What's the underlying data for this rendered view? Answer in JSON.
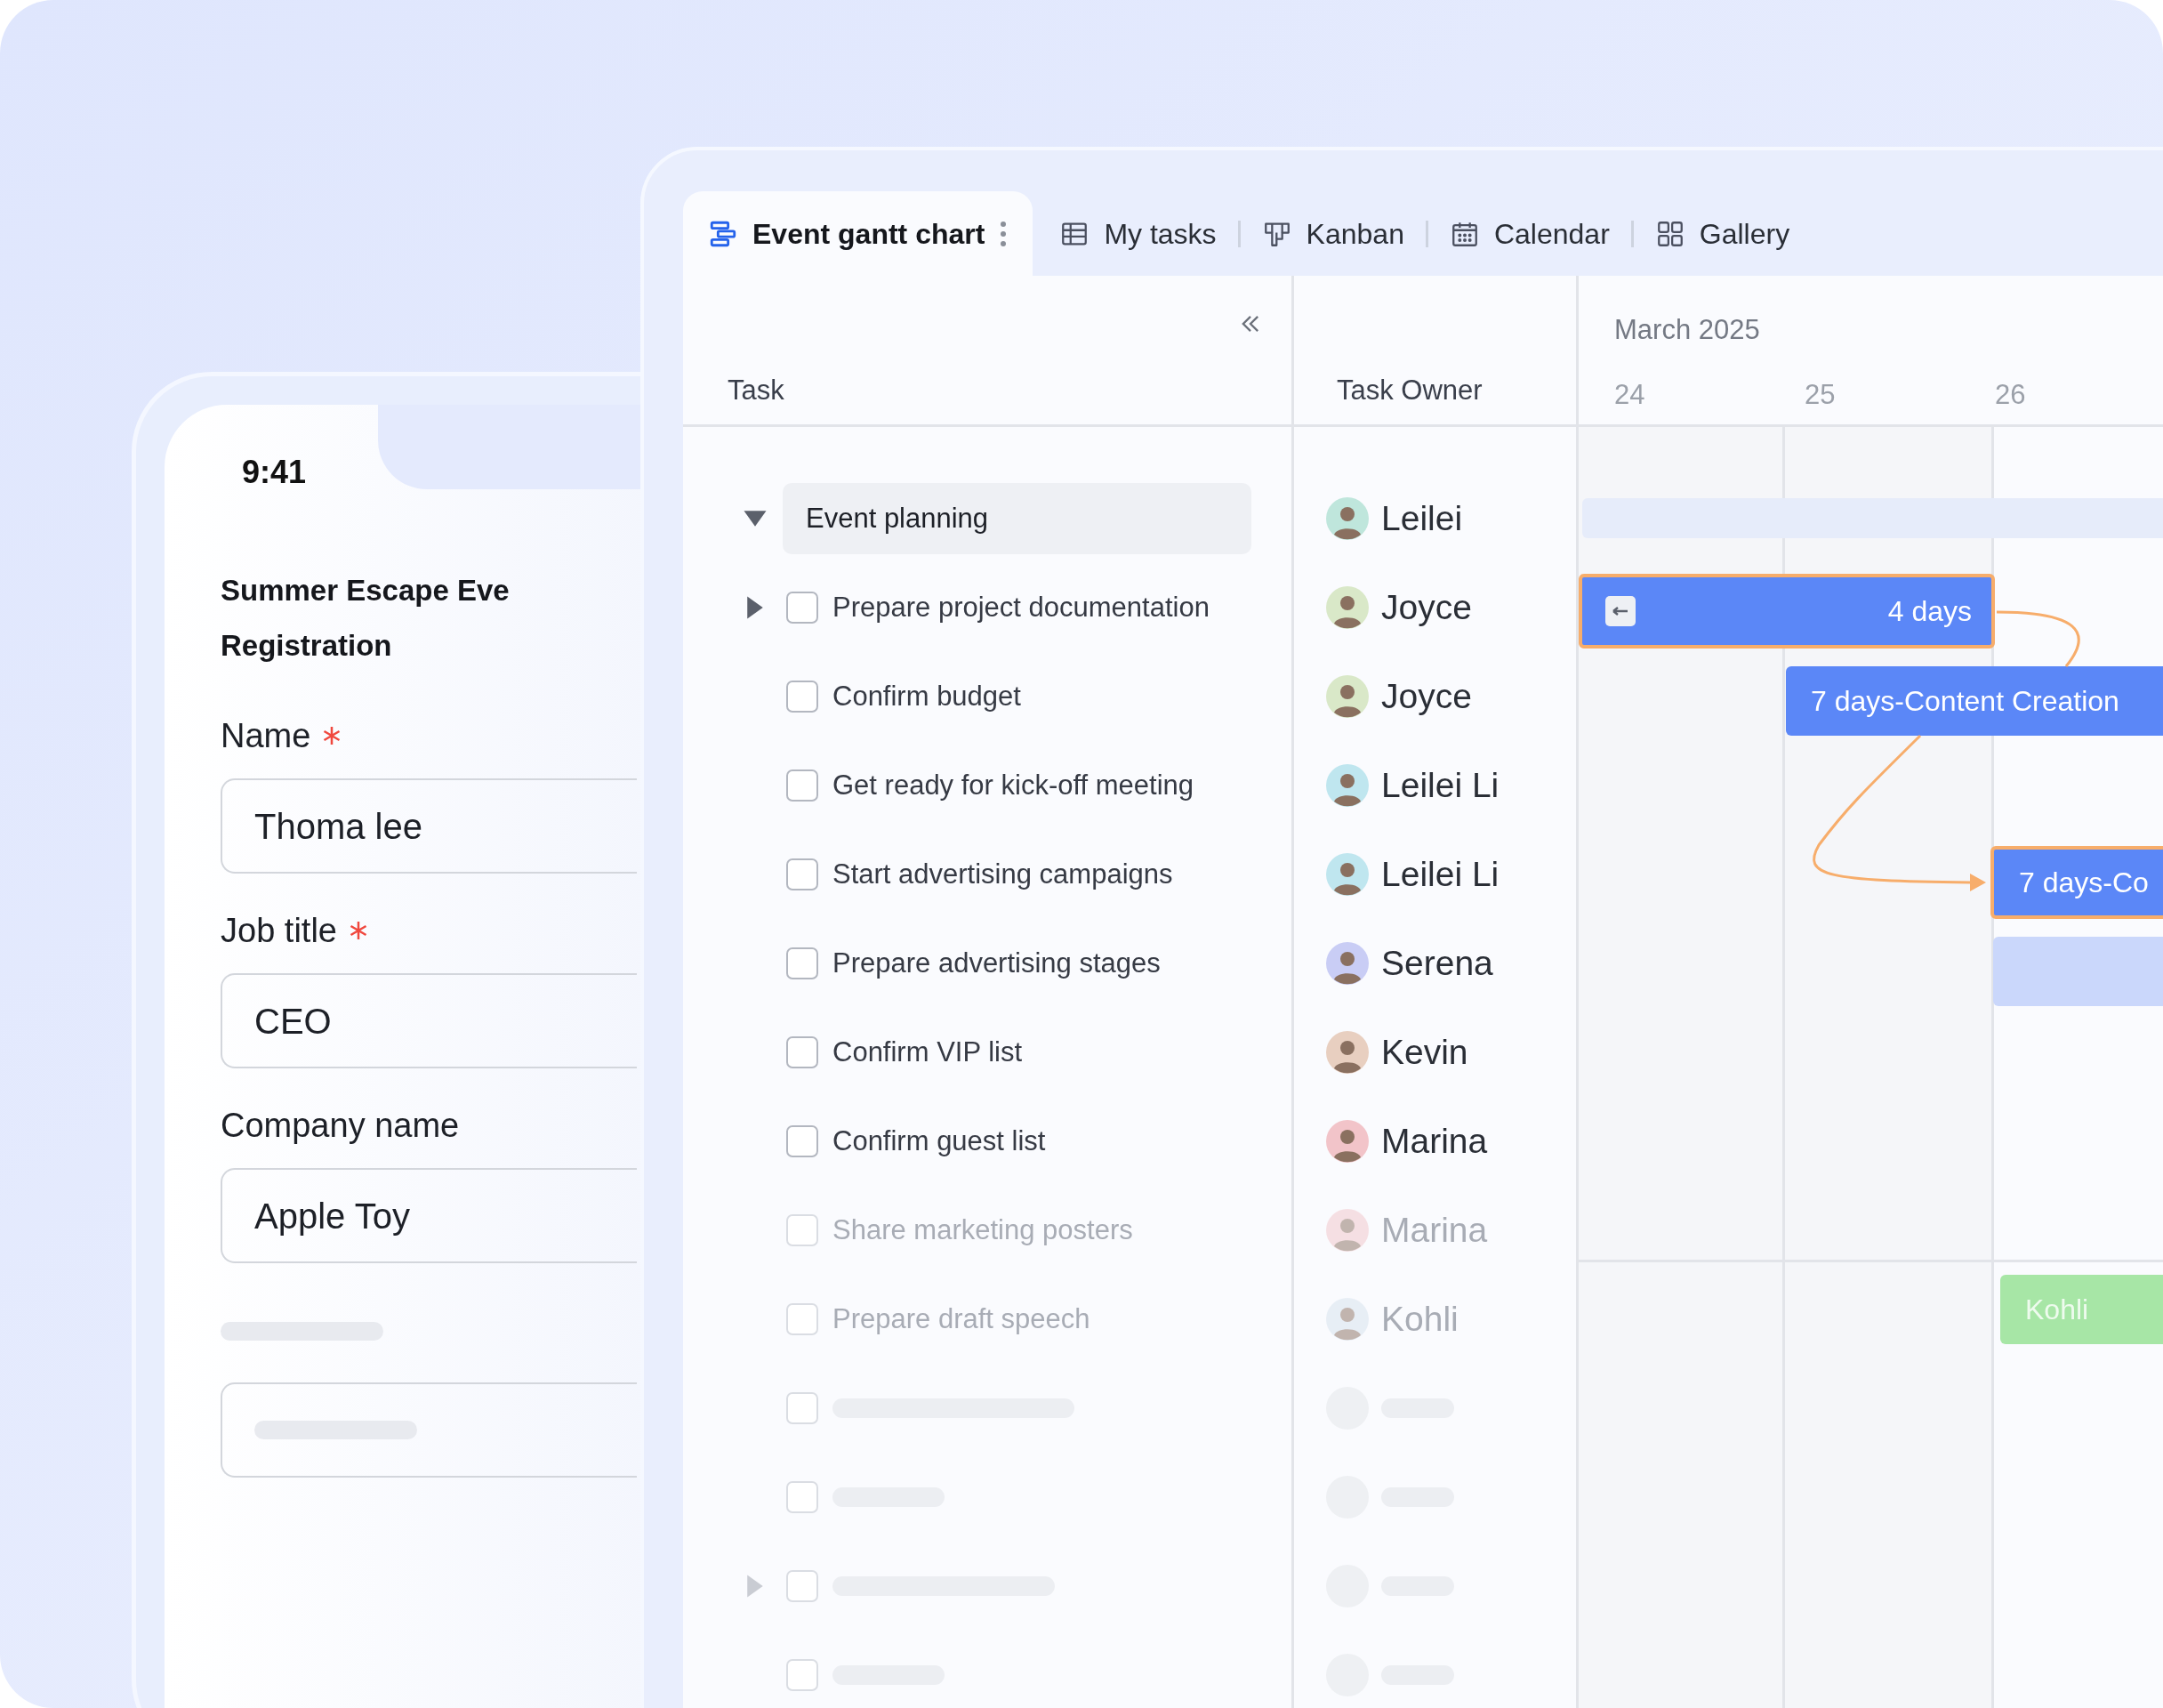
{
  "phone": {
    "time": "9:41",
    "title_lines": [
      "Summer Escape Eve",
      "Registration"
    ],
    "fields": [
      {
        "label": "Name",
        "required": true,
        "value": "Thoma lee"
      },
      {
        "label": "Job title",
        "required": true,
        "value": "CEO"
      },
      {
        "label": "Company name",
        "required": false,
        "value": "Apple Toy"
      },
      {
        "kind": "skeleton"
      }
    ]
  },
  "gantt": {
    "tabs": [
      {
        "label": "Event gantt chart",
        "selected": true
      },
      {
        "label": "My tasks",
        "selected": false
      },
      {
        "label": "Kanban",
        "selected": false
      },
      {
        "label": "Calendar",
        "selected": false
      },
      {
        "label": "Gallery",
        "selected": false
      }
    ],
    "columns": {
      "task": "Task",
      "owner": "Task Owner"
    },
    "timeline": {
      "month": "March 2025",
      "days": [
        "24",
        "25",
        "26"
      ]
    },
    "rows": [
      {
        "kind": "group",
        "label": "Event planning",
        "expandable": true,
        "expanded": true,
        "owner": "Leilei"
      },
      {
        "kind": "task",
        "label": "Prepare project documentation",
        "expandable": true,
        "expanded": false,
        "checked": false,
        "owner": "Joyce",
        "dimmed": false
      },
      {
        "kind": "task",
        "label": "Confirm budget",
        "expandable": false,
        "checked": false,
        "owner": "Joyce",
        "dimmed": false
      },
      {
        "kind": "task",
        "label": "Get ready for kick-off meeting",
        "expandable": false,
        "checked": false,
        "owner": "Leilei Li",
        "dimmed": false
      },
      {
        "kind": "task",
        "label": "Start advertising campaigns",
        "expandable": false,
        "checked": false,
        "owner": "Leilei Li",
        "dimmed": false
      },
      {
        "kind": "task",
        "label": "Prepare advertising stages",
        "expandable": false,
        "checked": false,
        "owner": "Serena",
        "dimmed": false
      },
      {
        "kind": "task",
        "label": "Confirm VIP list",
        "expandable": false,
        "checked": false,
        "owner": "Kevin",
        "dimmed": false
      },
      {
        "kind": "task",
        "label": "Confirm guest list",
        "expandable": false,
        "checked": false,
        "owner": "Marina",
        "dimmed": false
      },
      {
        "kind": "task",
        "label": "Share marketing posters",
        "expandable": false,
        "checked": false,
        "owner": "Marina",
        "dimmed": true
      },
      {
        "kind": "task",
        "label": "Prepare draft speech",
        "expandable": false,
        "checked": false,
        "owner": "Kohli",
        "dimmed": true
      },
      {
        "kind": "skeleton",
        "expandable": false,
        "checked": false
      },
      {
        "kind": "skeleton",
        "expandable": false,
        "checked": false
      },
      {
        "kind": "skeleton",
        "expandable": true,
        "expanded": false,
        "checked": false
      },
      {
        "kind": "skeleton",
        "expandable": false,
        "checked": false
      }
    ],
    "bars": [
      {
        "kind": "band",
        "color": "#e6ecfa",
        "highlighted": false
      },
      {
        "kind": "task",
        "label": "4 days",
        "color": "#5b87f7",
        "highlighted": true
      },
      {
        "kind": "task",
        "label": "7 days-Content Creation",
        "color": "#5b87f7",
        "highlighted": false
      },
      {
        "kind": "task",
        "label": "7 days-Co",
        "color": "#5b87f7",
        "highlighted": true
      },
      {
        "kind": "band",
        "color": "#cad7fb",
        "highlighted": false
      },
      {
        "kind": "task",
        "label": "Kohli",
        "color": "#a7e6a6",
        "highlighted": false
      }
    ]
  }
}
